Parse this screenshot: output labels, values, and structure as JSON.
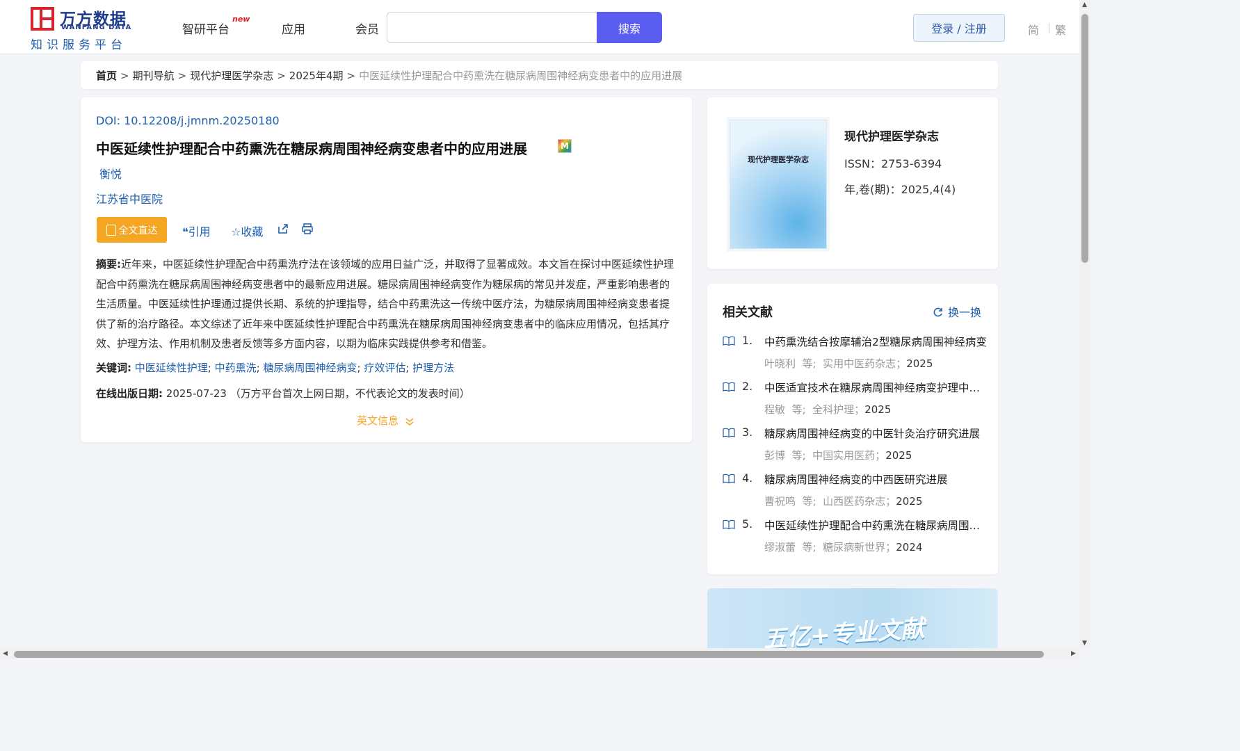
{
  "header": {
    "logo_cn": "万方数据",
    "logo_en": "WANFANG DATA",
    "logo_sub": "知识服务平台",
    "nav": [
      {
        "label": "智研平台"
      },
      {
        "label": "应用"
      },
      {
        "label": "会员"
      }
    ],
    "nav_new_badge": "new",
    "search_value": "",
    "search_button": "搜索",
    "login_button": "登录 / 注册",
    "lang_simplified": "简",
    "lang_traditional": "繁"
  },
  "breadcrumb": {
    "home": "首页",
    "items": [
      "期刊导航",
      "现代护理医学杂志",
      "2025年4期"
    ],
    "current": "中医延续性护理配合中药熏洗在糖尿病周围神经病变患者中的应用进展",
    "separator": ">"
  },
  "article": {
    "doi_label": "DOI:",
    "doi": "10.12208/j.jmnm.20250180",
    "title": "中医延续性护理配合中药熏洗在糖尿病周围神经病变患者中的应用进展",
    "badge": "M",
    "author": "衡悦",
    "organization": "江苏省中医院",
    "fulltext_button": "全文直达",
    "actions": {
      "cite": "引用",
      "favorite": "收藏"
    },
    "abstract_label": "摘要:",
    "abstract": "近年来，中医延续性护理配合中药熏洗疗法在该领域的应用日益广泛，并取得了显著成效。本文旨在探讨中医延续性护理配合中药熏洗在糖尿病周围神经病变患者中的最新应用进展。糖尿病周围神经病变作为糖尿病的常见并发症，严重影响患者的生活质量。中医延续性护理通过提供长期、系统的护理指导，结合中药熏洗这一传统中医疗法，为糖尿病周围神经病变患者提供了新的治疗路径。本文综述了近年来中医延续性护理配合中药熏洗在糖尿病周围神经病变患者中的临床应用情况，包括其疗效、护理方法、作用机制及患者反馈等多方面内容，以期为临床实践提供参考和借鉴。",
    "keywords_label": "关键词:",
    "keywords": [
      "中医延续性护理",
      "中药熏洗",
      "糖尿病周围神经病变",
      "疗效评估",
      "护理方法"
    ],
    "published_label": "在线出版日期:",
    "published_date": "2025-07-23",
    "published_note": "（万方平台首次上网日期，不代表论文的发表时间）",
    "english_info": "英文信息"
  },
  "journal": {
    "cover_title": "现代护理医学杂志",
    "name": "现代护理医学杂志",
    "issn": "ISSN：2753-6394",
    "volume": "年,卷(期)：2025,4(4)"
  },
  "related": {
    "title": "相关文献",
    "refresh": "换一换",
    "items": [
      {
        "num": "1.",
        "title": "中药熏洗结合按摩辅治2型糖尿病周围神经病变",
        "author": "叶晓利",
        "etal": "等;",
        "source": "实用中医药杂志；",
        "year": "2025"
      },
      {
        "num": "2.",
        "title": "中医适宜技术在糖尿病周围神经病变护理中的应用",
        "author": "程敏",
        "etal": "等;",
        "source": "全科护理；",
        "year": "2025"
      },
      {
        "num": "3.",
        "title": "糖尿病周围神经病变的中医针灸治疗研究进展",
        "author": "彭博",
        "etal": "等;",
        "source": "中国实用医药；",
        "year": "2025"
      },
      {
        "num": "4.",
        "title": "糖尿病周围神经病变的中西医研究进展",
        "author": "曹祝鸣",
        "etal": "等;",
        "source": "山西医药杂志；",
        "year": "2025"
      },
      {
        "num": "5.",
        "title": "中医延续性护理配合中药熏洗在糖尿病周围神经病变",
        "author": "缪淑蕾",
        "etal": "等;",
        "source": "糖尿病新世界；",
        "year": "2024"
      }
    ]
  },
  "banner": {
    "text": "五亿+专业文献"
  }
}
